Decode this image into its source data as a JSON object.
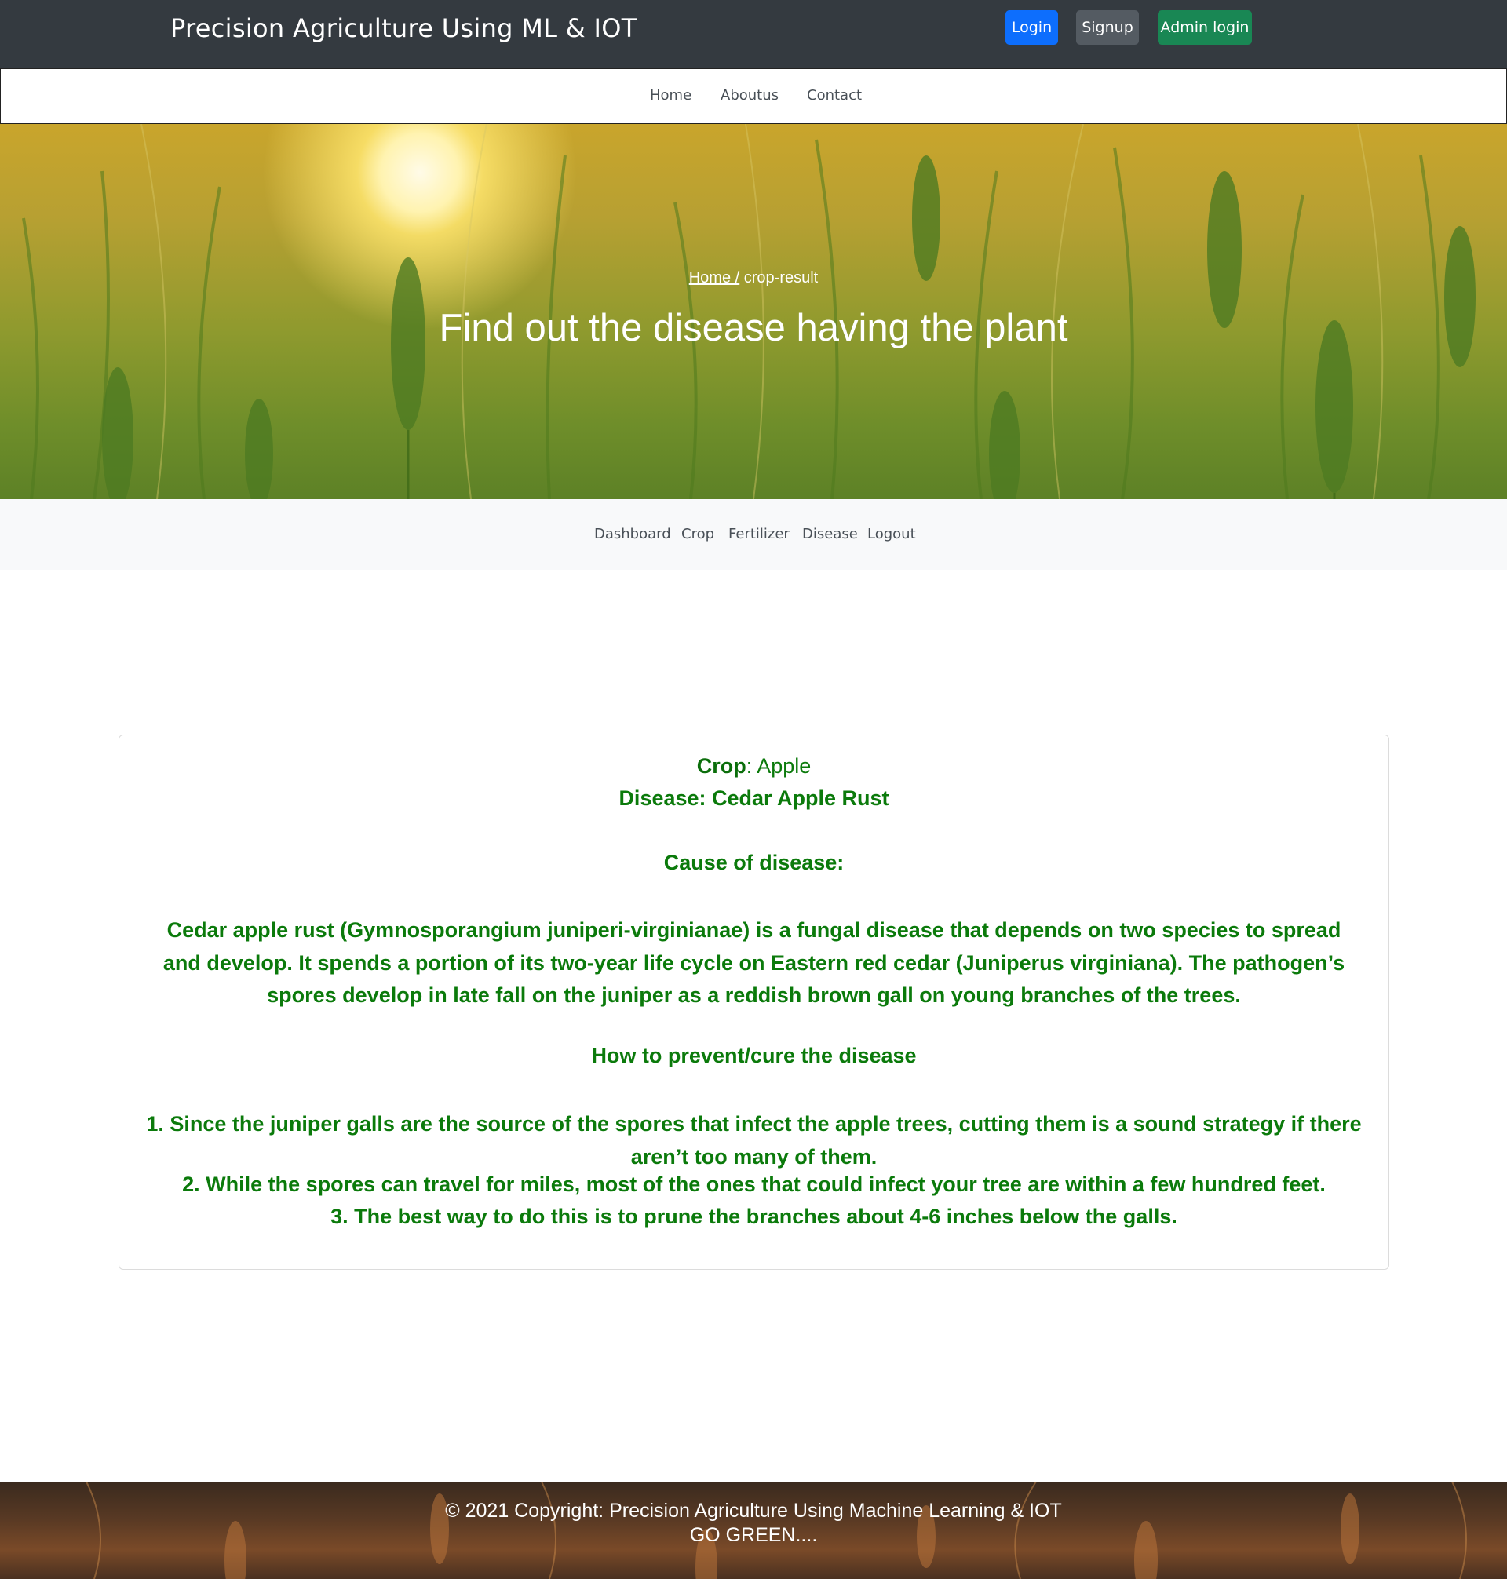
{
  "header": {
    "brand": "Precision Agriculture Using ML & IOT",
    "login_label": "Login",
    "signup_label": "Signup",
    "admin_login_label": "Admin login",
    "colors": {
      "bar": "#343a40",
      "login": "#0d6efd",
      "signup": "#545b62",
      "admin": "#198754"
    }
  },
  "nav": {
    "items": [
      {
        "label": "Home"
      },
      {
        "label": "Aboutus"
      },
      {
        "label": "Contact"
      }
    ]
  },
  "hero": {
    "breadcrumb_home": "Home /",
    "breadcrumb_current": "crop-result",
    "title": "Find out the disease having the plant"
  },
  "subnav": {
    "items": [
      {
        "label": "Dashboard"
      },
      {
        "label": "Crop"
      },
      {
        "label": "Fertilizer"
      },
      {
        "label": "Disease"
      },
      {
        "label": "Logout"
      }
    ]
  },
  "result": {
    "crop_key": "Crop",
    "crop_value": ": Apple",
    "disease": "Disease: Cedar Apple Rust",
    "cause_heading": "Cause of disease:",
    "cause_text": "Cedar apple rust (Gymnosporangium juniperi-virginianae) is a fungal disease that depends on two species to spread and develop. It spends a portion of its two-year life cycle on Eastern red cedar (Juniperus virginiana). The pathogen’s spores develop in late fall on the juniper as a reddish brown gall on young branches of the trees.",
    "prevent_heading": "How to prevent/cure the disease",
    "steps": [
      "1. Since the juniper galls are the source of the spores that infect the apple trees, cutting them is a sound strategy if there aren’t too many of them.",
      "2. While the spores can travel for miles, most of the ones that could infect your tree are within a few hundred feet.",
      "3. The best way to do this is to prune the branches about 4-6 inches below the galls."
    ],
    "text_color": "#0b7a0b"
  },
  "footer": {
    "copyright": "© 2021 Copyright: Precision Agriculture Using Machine Learning & IOT",
    "tagline": "GO GREEN...."
  }
}
